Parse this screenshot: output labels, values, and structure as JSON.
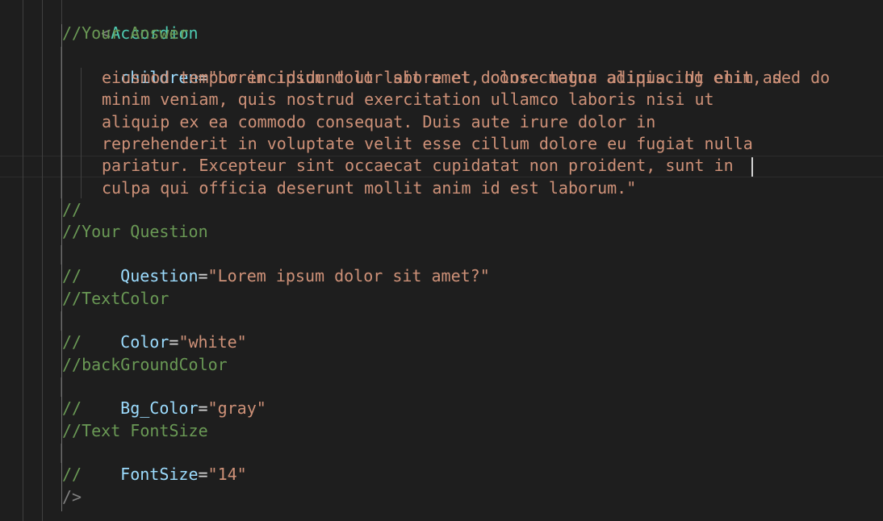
{
  "editor": {
    "open_tag": {
      "bracket": "<",
      "name": "Accordion"
    },
    "close_tag": "/>",
    "blocks": [
      {
        "comment": "//Your Answer",
        "attr": "children",
        "eq": "=",
        "value_lines": [
          "\"Lorem ipsum dolor sit amet, consectetur adipiscing elit, sed do",
          "eiusmod tempor incididunt ut labore et dolore magna aliqua. Ut enim ad",
          "minim veniam, quis nostrud exercitation ullamco laboris nisi ut",
          "aliquip ex ea commodo consequat. Duis aute irure dolor in",
          "reprehenderit in voluptate velit esse cillum dolore eu fugiat nulla",
          "pariatur. Excepteur sint occaecat cupidatat non proident, sunt in",
          "culpa qui officia deserunt mollit anim id est laborum.\""
        ],
        "end": "//"
      },
      {
        "comment": "//Your Question",
        "attr": "Question",
        "eq": "=",
        "value": "\"Lorem ipsum dolor sit amet?\"",
        "end": "//"
      },
      {
        "comment": "//TextColor",
        "attr": "Color",
        "eq": "=",
        "value": "\"white\"",
        "end": "//"
      },
      {
        "comment": "//backGroundColor",
        "attr": "Bg_Color",
        "eq": "=",
        "value": "\"gray\"",
        "end": "//"
      },
      {
        "comment": "//Text FontSize",
        "attr": "FontSize",
        "eq": "=",
        "value": "\"14\"",
        "end": "//"
      }
    ]
  }
}
